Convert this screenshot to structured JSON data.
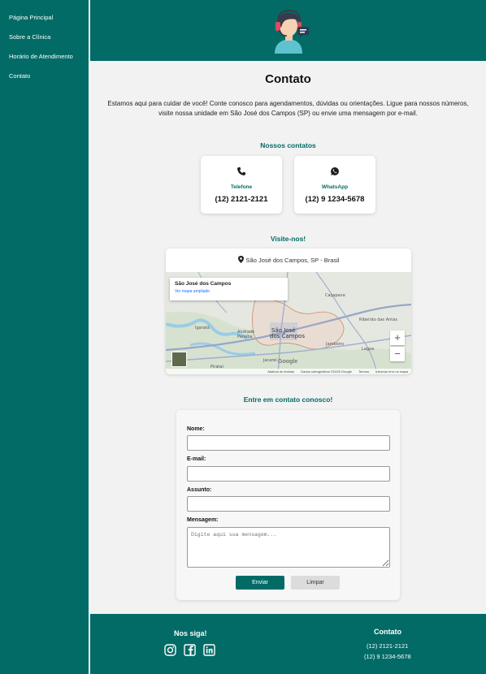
{
  "sidebar": {
    "items": [
      {
        "label": "Página Principal"
      },
      {
        "label": "Sobre a Clínica"
      },
      {
        "label": "Horário de Atendimento"
      },
      {
        "label": "Contato"
      }
    ]
  },
  "header": {
    "logo_icon": "support-agent-icon"
  },
  "main": {
    "title": "Contato",
    "intro": "Estamos aqui para cuidar de você! Conte conosco para agendamentos, dúvidas ou orientações. Ligue para nossos números, visite nossa unidade em São José dos Campos (SP) ou envie uma mensagem por e-mail.",
    "contacts_title": "Nossos contatos",
    "contacts": [
      {
        "icon": "phone-icon",
        "label": "Telefone",
        "value": "(12) 2121-2121"
      },
      {
        "icon": "whatsapp-icon",
        "label": "WhatsApp",
        "value": "(12) 9 1234-5678"
      }
    ],
    "visit_title": "Visite-nos!",
    "map": {
      "address": "São José dos Campos, SP - Brasil",
      "info_city": "São José dos Campos",
      "info_link": "Ver mapa ampliado",
      "zoom_in": "+",
      "zoom_out": "−",
      "google": "Google",
      "center_label_1": "São José",
      "center_label_2": "dos Campos",
      "footer": [
        "Atalhos do teclado",
        "Dados cartográficos ©2025 Google",
        "Termos",
        "Informar erro no mapa"
      ],
      "places": [
        "Caçapava",
        "Jacareí",
        "Jambeiro",
        "Andrade",
        "Paraíba",
        "Ribeirão das Antas",
        "Igaratá",
        "Redenção da Serra",
        "Pirataí",
        "São Silvestre",
        "Santa Isabel",
        "Lagoa"
      ]
    },
    "form_title": "Entre em contato conosco!",
    "form": {
      "name_label": "Nome:",
      "name_value": "",
      "email_label": "E-mail:",
      "email_value": "",
      "subject_label": "Assunto:",
      "subject_value": "",
      "message_label": "Mensagem:",
      "message_placeholder": "Digite aqui sua mensagem...",
      "send_label": "Enviar",
      "clear_label": "Limpar"
    }
  },
  "footer": {
    "follow_title": "Nos siga!",
    "social": [
      "instagram-icon",
      "facebook-icon",
      "linkedin-icon"
    ],
    "contact_title": "Contato",
    "phone": "(12) 2121-2121",
    "whatsapp": "(12) 9 1234-5678"
  },
  "colors": {
    "primary": "#026b66",
    "background": "#f2f2f2",
    "link": "#1a73e8"
  }
}
